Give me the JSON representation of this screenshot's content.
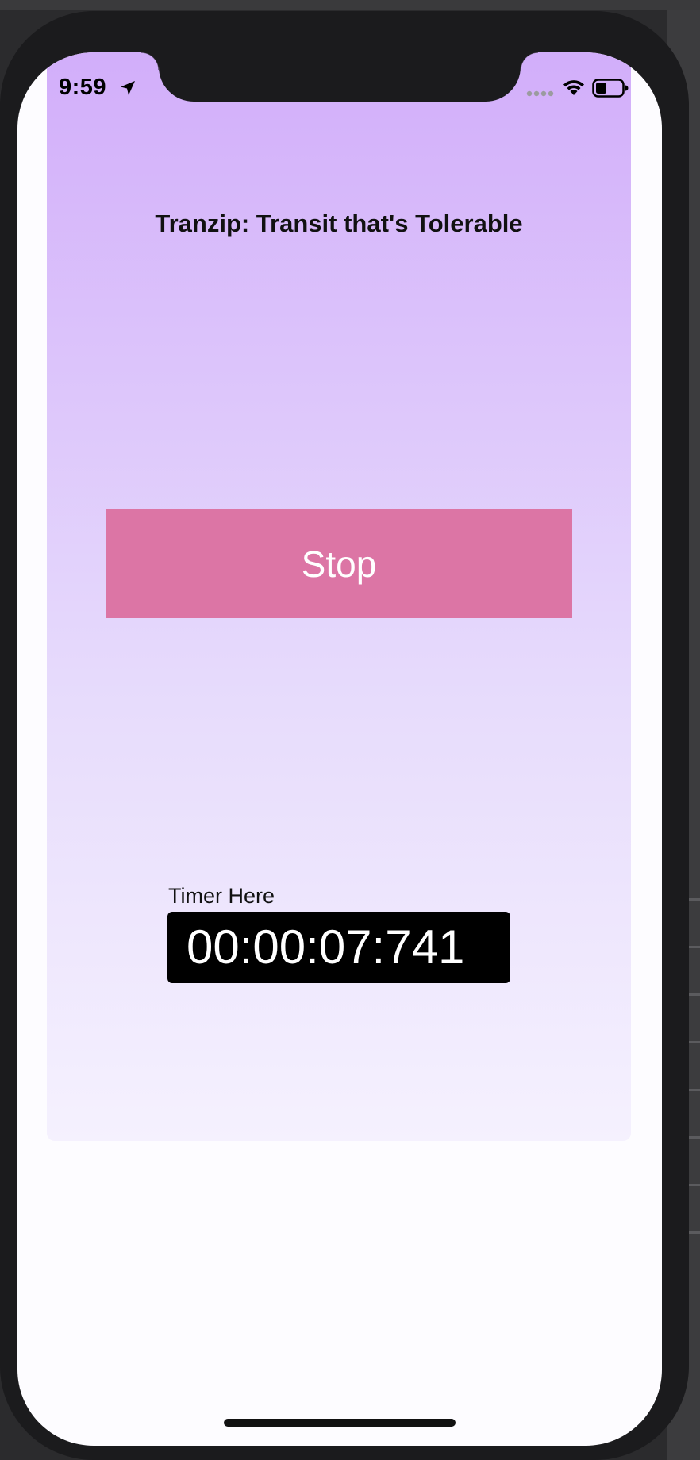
{
  "status_bar": {
    "time": "9:59",
    "icons": [
      "location-arrow-icon",
      "cellular-signal-icon",
      "wifi-icon",
      "battery-icon"
    ]
  },
  "app": {
    "title": "Tranzip: Transit that's Tolerable",
    "stop_button_label": "Stop",
    "timer_label": "Timer Here",
    "timer_value": "00:00:07:741"
  },
  "colors": {
    "gradient_top": "#d2aefa",
    "gradient_bottom": "#f5f1fe",
    "stop_button": "#dc75a5",
    "timer_background": "#000000",
    "timer_text": "#ffffff",
    "device_frame": "#1b1b1d"
  }
}
